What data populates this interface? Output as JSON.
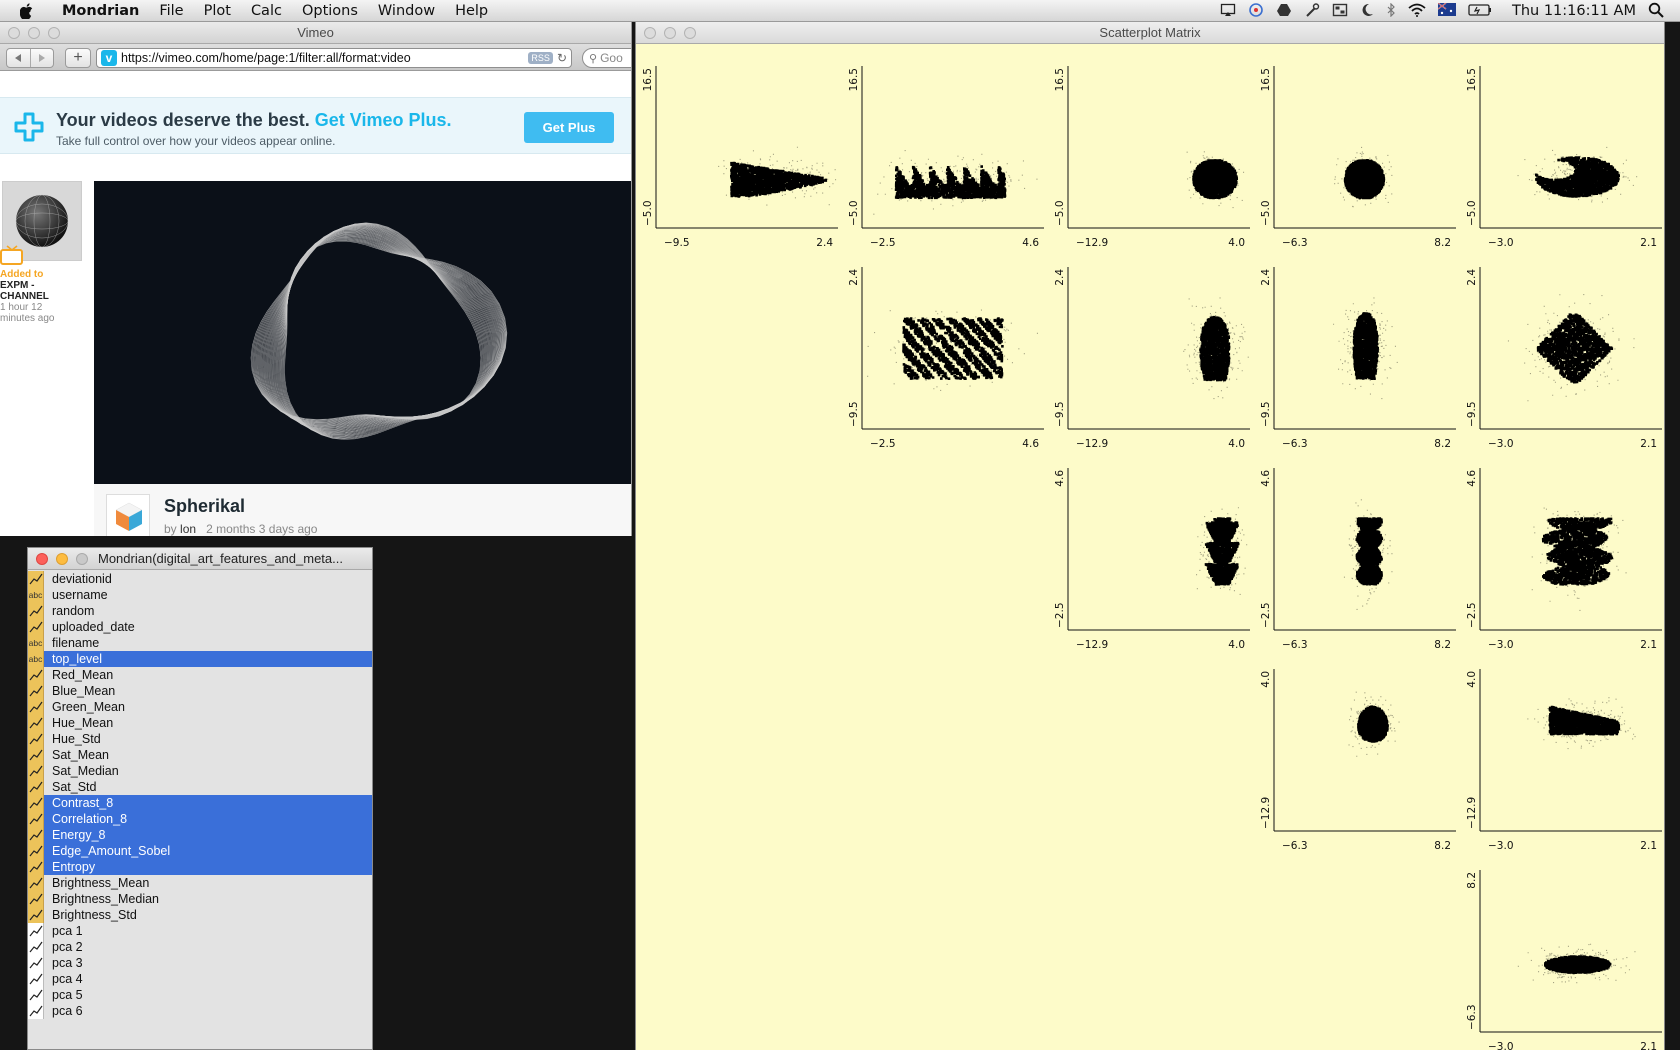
{
  "menubar": {
    "app_name": "Mondrian",
    "menus": [
      "File",
      "Plot",
      "Calc",
      "Options",
      "Window",
      "Help"
    ],
    "status_icons": [
      "airplay-icon",
      "dropbox-icon",
      "drive-icon",
      "tools-icon",
      "app-icon",
      "moon-icon",
      "bluetooth-icon",
      "wifi-icon",
      "flag-icon",
      "battery-icon"
    ],
    "clock": "Thu 11:16:11 AM"
  },
  "browser": {
    "window_title": "Vimeo",
    "url": "https://vimeo.com/home/page:1/filter:all/format:video",
    "rss_label": "RSS",
    "search_placeholder": "Goo",
    "promo": {
      "headline": "Your videos deserve the best.",
      "headline_link": "Get Vimeo Plus.",
      "subline": "Take full control over how your videos appear online.",
      "button": "Get Plus"
    },
    "activity": {
      "added_to": "Added to",
      "channel": "EXPM - CHANNEL",
      "time": "1 hour 12 minutes ago"
    },
    "video": {
      "title": "Spherikal",
      "by_prefix": "by",
      "author": "lon",
      "age": "2 months 3 days ago"
    }
  },
  "variables_window": {
    "title": "Mondrian(digital_art_features_and_meta...",
    "variables": [
      {
        "name": "deviationid",
        "type": "num",
        "selected": false
      },
      {
        "name": "username",
        "type": "abc",
        "selected": false
      },
      {
        "name": "random",
        "type": "num",
        "selected": false
      },
      {
        "name": "uploaded_date",
        "type": "num",
        "selected": false
      },
      {
        "name": "filename",
        "type": "abc",
        "selected": false
      },
      {
        "name": "top_level",
        "type": "abc",
        "selected": true
      },
      {
        "name": "Red_Mean",
        "type": "num",
        "selected": false
      },
      {
        "name": "Blue_Mean",
        "type": "num",
        "selected": false
      },
      {
        "name": "Green_Mean",
        "type": "num",
        "selected": false
      },
      {
        "name": "Hue_Mean",
        "type": "num",
        "selected": false
      },
      {
        "name": "Hue_Std",
        "type": "num",
        "selected": false
      },
      {
        "name": "Sat_Mean",
        "type": "num",
        "selected": false
      },
      {
        "name": "Sat_Median",
        "type": "num",
        "selected": false
      },
      {
        "name": "Sat_Std",
        "type": "num",
        "selected": false
      },
      {
        "name": "Contrast_8",
        "type": "num",
        "selected": true
      },
      {
        "name": "Correlation_8",
        "type": "num",
        "selected": true
      },
      {
        "name": "Energy_8",
        "type": "num",
        "selected": true
      },
      {
        "name": "Edge_Amount_Sobel",
        "type": "num",
        "selected": true
      },
      {
        "name": "Entropy",
        "type": "num",
        "selected": true
      },
      {
        "name": "Brightness_Mean",
        "type": "num",
        "selected": false
      },
      {
        "name": "Brightness_Median",
        "type": "num",
        "selected": false
      },
      {
        "name": "Brightness_Std",
        "type": "num",
        "selected": false
      },
      {
        "name": "pca 1",
        "type": "plain",
        "selected": false
      },
      {
        "name": "pca 2",
        "type": "plain",
        "selected": false
      },
      {
        "name": "pca 3",
        "type": "plain",
        "selected": false
      },
      {
        "name": "pca 4",
        "type": "plain",
        "selected": false
      },
      {
        "name": "pca 5",
        "type": "plain",
        "selected": false
      },
      {
        "name": "pca 6",
        "type": "plain",
        "selected": false
      }
    ]
  },
  "scatter_window": {
    "title": "Scatterplot Matrix"
  },
  "chart_data": {
    "type": "scatter",
    "layout": "upper-triangular scatterplot matrix, 5 rows x 5 columns",
    "point_color": "#000000",
    "background": "#fdfbc9",
    "column_x_ranges": [
      [
        -9.5,
        2.4
      ],
      [
        -2.5,
        4.6
      ],
      [
        -12.9,
        4.0
      ],
      [
        -6.3,
        8.2
      ],
      [
        -3.0,
        2.1
      ]
    ],
    "row_y_ranges": [
      [
        -5.0,
        16.5
      ],
      [
        -9.5,
        2.4
      ],
      [
        -2.5,
        4.6
      ],
      [
        -12.9,
        4.0
      ],
      [
        -6.3,
        8.2
      ]
    ],
    "x_tick_labels": [
      [
        "−9.5",
        "2.4"
      ],
      [
        "−2.5",
        "4.6"
      ],
      [
        "−12.9",
        "4.0"
      ],
      [
        "−6.3",
        "8.2"
      ],
      [
        "−3.0",
        "2.1"
      ]
    ],
    "y_tick_labels": [
      [
        "−5.0",
        "16.5"
      ],
      [
        "−9.5",
        "2.4"
      ],
      [
        "−2.5",
        "4.6"
      ],
      [
        "−12.9",
        "4.0"
      ],
      [
        "−6.3",
        "8.2"
      ]
    ],
    "panels": [
      {
        "row": 0,
        "col": 0,
        "shape": "wedge",
        "cx": -1.5,
        "cy": 1.5,
        "sx": 3.2,
        "sy": 2.4
      },
      {
        "row": 0,
        "col": 1,
        "shape": "comb",
        "cx": 0.9,
        "cy": 1.0,
        "sx": 2.2,
        "sy": 2.6
      },
      {
        "row": 0,
        "col": 2,
        "shape": "blob",
        "cx": 0.8,
        "cy": 1.5,
        "sx": 2.2,
        "sy": 2.6
      },
      {
        "row": 0,
        "col": 3,
        "shape": "blob",
        "cx": 0.8,
        "cy": 1.5,
        "sx": 1.7,
        "sy": 2.6
      },
      {
        "row": 0,
        "col": 4,
        "shape": "crescent",
        "cx": -0.3,
        "cy": 1.8,
        "sx": 1.2,
        "sy": 2.7
      },
      {
        "row": 1,
        "col": 1,
        "shape": "stripes",
        "cx": 1.0,
        "cy": -3.5,
        "sx": 2.0,
        "sy": 2.3
      },
      {
        "row": 1,
        "col": 2,
        "shape": "teardrop",
        "cx": 0.8,
        "cy": -3.5,
        "sx": 2.4,
        "sy": 2.4
      },
      {
        "row": 1,
        "col": 3,
        "shape": "teardrop",
        "cx": 0.9,
        "cy": -3.3,
        "sx": 1.7,
        "sy": 2.5
      },
      {
        "row": 1,
        "col": 4,
        "shape": "diamond",
        "cx": -0.4,
        "cy": -3.5,
        "sx": 1.1,
        "sy": 2.6
      },
      {
        "row": 2,
        "col": 2,
        "shape": "tree",
        "cx": 1.5,
        "cy": 1.0,
        "sx": 1.8,
        "sy": 1.5
      },
      {
        "row": 2,
        "col": 3,
        "shape": "column",
        "cx": 1.2,
        "cy": 1.0,
        "sx": 1.3,
        "sy": 1.5
      },
      {
        "row": 2,
        "col": 4,
        "shape": "column-wide",
        "cx": -0.3,
        "cy": 1.0,
        "sx": 1.0,
        "sy": 1.5
      },
      {
        "row": 3,
        "col": 3,
        "shape": "blob-small",
        "cx": 1.5,
        "cy": -1.5,
        "sx": 1.4,
        "sy": 2.2
      },
      {
        "row": 3,
        "col": 4,
        "shape": "fan",
        "cx": -0.1,
        "cy": -1.5,
        "sx": 1.0,
        "sy": 2.0
      },
      {
        "row": 4,
        "col": 4,
        "shape": "ellipse",
        "cx": -0.3,
        "cy": -0.2,
        "sx": 1.0,
        "sy": 1.3
      }
    ]
  }
}
